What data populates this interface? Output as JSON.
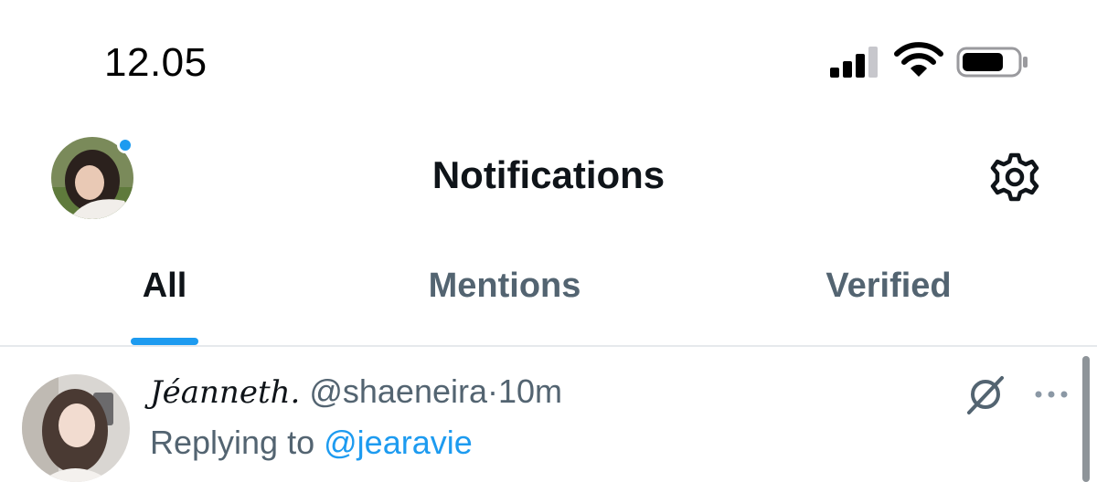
{
  "status_bar": {
    "time": "12.05"
  },
  "header": {
    "title": "Notifications"
  },
  "tabs": [
    {
      "label": "All",
      "active": true
    },
    {
      "label": "Mentions",
      "active": false
    },
    {
      "label": "Verified",
      "active": false
    }
  ],
  "notification": {
    "display_name": "Jéanneth.",
    "handle": "@shaeneira",
    "separator": "·",
    "time": "10m",
    "replying_prefix": "Replying to",
    "replying_to": "@jearavie"
  },
  "icons": {
    "signal": "signal-icon",
    "wifi": "wifi-icon",
    "battery": "battery-icon",
    "settings": "gear-icon",
    "grok": "grok-icon",
    "more": "more-icon"
  },
  "colors": {
    "accent": "#1d9bf0",
    "text": "#0f1419",
    "muted": "#536471"
  }
}
